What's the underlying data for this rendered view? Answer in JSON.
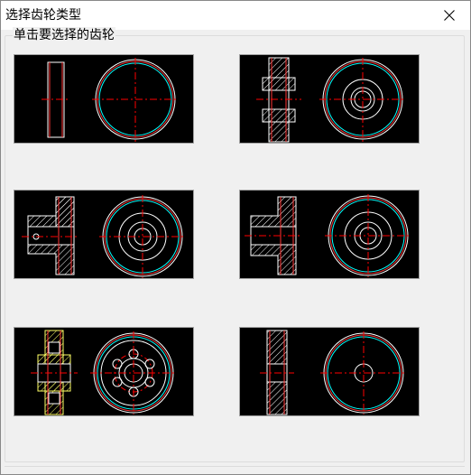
{
  "window": {
    "title": "选择齿轮类型",
    "close_icon": "close-icon"
  },
  "group": {
    "label": "单击要选择的齿轮"
  },
  "gear_options": [
    {
      "icon": "spur-gear-solid-disc-icon"
    },
    {
      "icon": "spur-gear-with-hub-icon"
    },
    {
      "icon": "gear-single-hub-keyed-icon"
    },
    {
      "icon": "gear-single-hub-icon"
    },
    {
      "icon": "gear-web-with-holes-icon"
    },
    {
      "icon": "gear-plain-bore-icon"
    }
  ],
  "colors": {
    "drawing_background": "#000000",
    "outline": "#ffffff",
    "centerline": "#ff0000",
    "pitch_circle": "#00ffff",
    "highlight": "#ffff66"
  }
}
